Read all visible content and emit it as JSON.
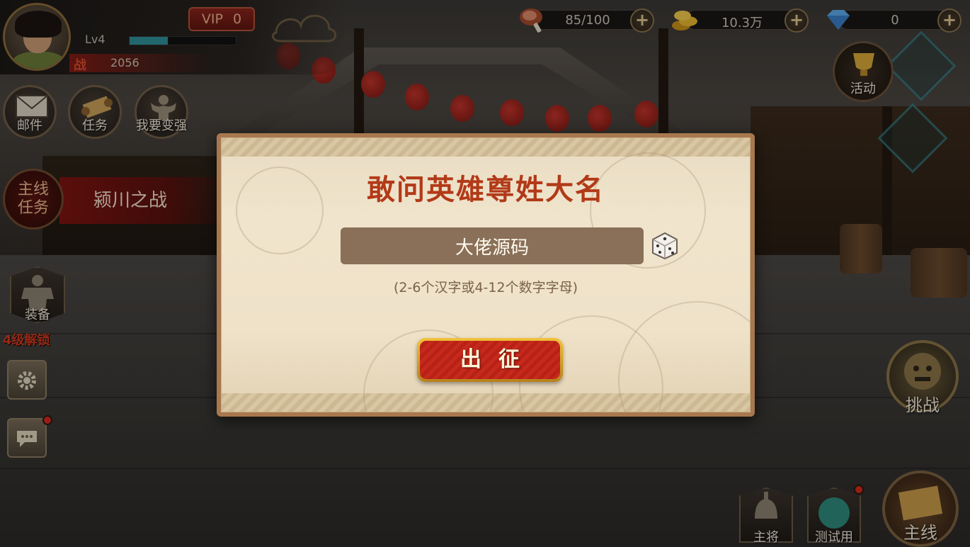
{
  "player": {
    "vip_label": "VIP",
    "vip_level": "0",
    "level": "Lv4",
    "exp_fraction": 0.36,
    "power_icon": "战",
    "power": "2056"
  },
  "resources": {
    "stamina": "85/100",
    "gold": "10.3万",
    "gems": "0",
    "plus": "+"
  },
  "left_menu": {
    "mail": "邮件",
    "quest": "任务",
    "stronger": "我要变强",
    "main_quest_badge": "主线任务",
    "main_quest_name": "颍川之战",
    "equip": "装备",
    "equip_unlock": "4级解锁"
  },
  "right_menu": {
    "activity": "活动",
    "challenge": "挑战",
    "general": "主将",
    "test": "测试用",
    "mainline": "主线"
  },
  "dialog": {
    "title": "敢问英雄尊姓大名",
    "name_value": "大佬源码",
    "hint": "(2-6个汉字或4-12个数字字母)",
    "go_label": "出征"
  },
  "icons": {
    "mail": "envelope-icon",
    "quest": "scroll-icon",
    "stronger": "muscle-icon",
    "settings": "gear-icon",
    "chat": "chat-bubble-icon",
    "dice": "dice-icon",
    "stamina": "meat-icon",
    "gold": "gold-coins-icon",
    "gems": "diamond-icon"
  },
  "colors": {
    "title_red": "#b23a18",
    "button_red": "#c62a1c",
    "button_gold": "#f2c23c",
    "dialog_bg": "#efe2c9"
  }
}
